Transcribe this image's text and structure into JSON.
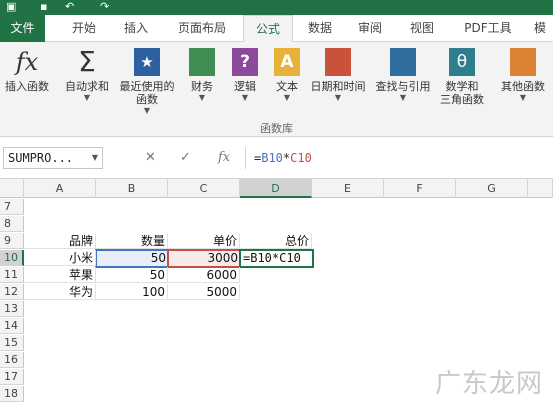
{
  "tabs": {
    "file": "文件",
    "items": [
      "开始",
      "插入",
      "页面布局",
      "公式",
      "数据",
      "审阅",
      "视图",
      "PDF工具",
      "模"
    ],
    "active": "公式"
  },
  "ribbon": {
    "insert_function": "插入函数",
    "autosum": "自动求和",
    "recent": [
      "最近使用的",
      "函数"
    ],
    "financial": "财务",
    "logical": "逻辑",
    "text": "文本",
    "datetime": "日期和时间",
    "lookup": "查找与引用",
    "math": [
      "数学和",
      "三角函数"
    ],
    "more": "其他函数",
    "group_label": "函数库",
    "fx_glyph": "fx",
    "sigma_glyph": "Σ",
    "star_glyph": "★",
    "question_glyph": "?",
    "text_glyph": "A",
    "theta_glyph": "θ",
    "dropdown_glyph": "▼"
  },
  "formula_bar": {
    "name_box": "SUMPRO...",
    "cancel": "✕",
    "enter": "✓",
    "fx": "fx",
    "formula_prefix": "=",
    "ref1": "B10",
    "op": "*",
    "ref2": "C10"
  },
  "grid": {
    "columns": [
      "A",
      "B",
      "C",
      "D",
      "E",
      "F",
      "G"
    ],
    "selected_column": "D",
    "rows": [
      "7",
      "8",
      "9",
      "10",
      "11",
      "12",
      "13",
      "14",
      "15",
      "16",
      "17",
      "18"
    ],
    "selected_row": "10",
    "cells": {
      "A9": "品牌",
      "B9": "数量",
      "C9": "单价",
      "D9": "总价",
      "A10": "小米",
      "B10": "50",
      "C10": "3000",
      "D10": "=B10*C10",
      "A11": "苹果",
      "B11": "50",
      "C11": "6000",
      "A12": "华为",
      "B12": "100",
      "C12": "5000"
    }
  },
  "watermark": "广东龙网",
  "colors": {
    "excel_green": "#217346",
    "ref_blue": "#4472c4",
    "ref_red": "#c0504d"
  }
}
